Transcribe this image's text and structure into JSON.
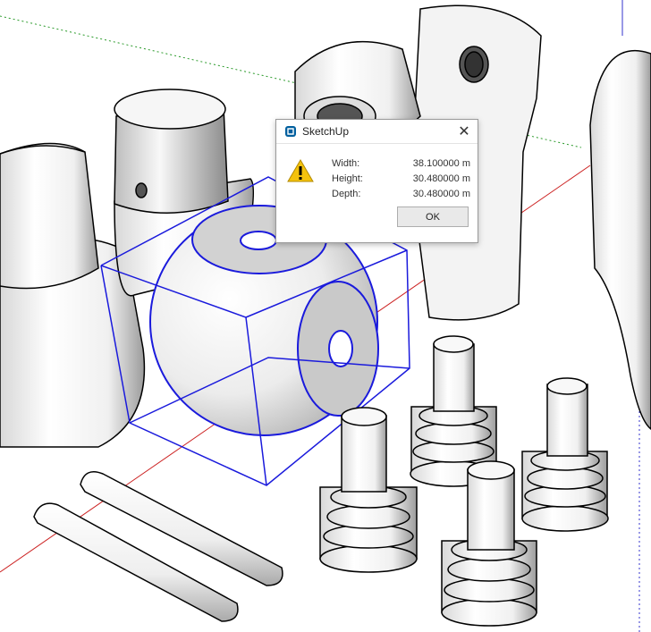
{
  "dialog": {
    "title": "SketchUp",
    "close_glyph": "✕",
    "icon": "warning-icon",
    "app_icon": "sketchup-logo-icon",
    "fields": [
      {
        "label": "Width:",
        "value": "38.100000 m"
      },
      {
        "label": "Height:",
        "value": "30.480000 m"
      },
      {
        "label": "Depth:",
        "value": "30.480000 m"
      }
    ],
    "ok_label": "OK"
  },
  "colors": {
    "selection": "#1a1adc",
    "axis_red": "#cc2222",
    "axis_green": "#2a9a2a",
    "axis_blue": "#3333cc",
    "warning": "#f4c20d"
  }
}
